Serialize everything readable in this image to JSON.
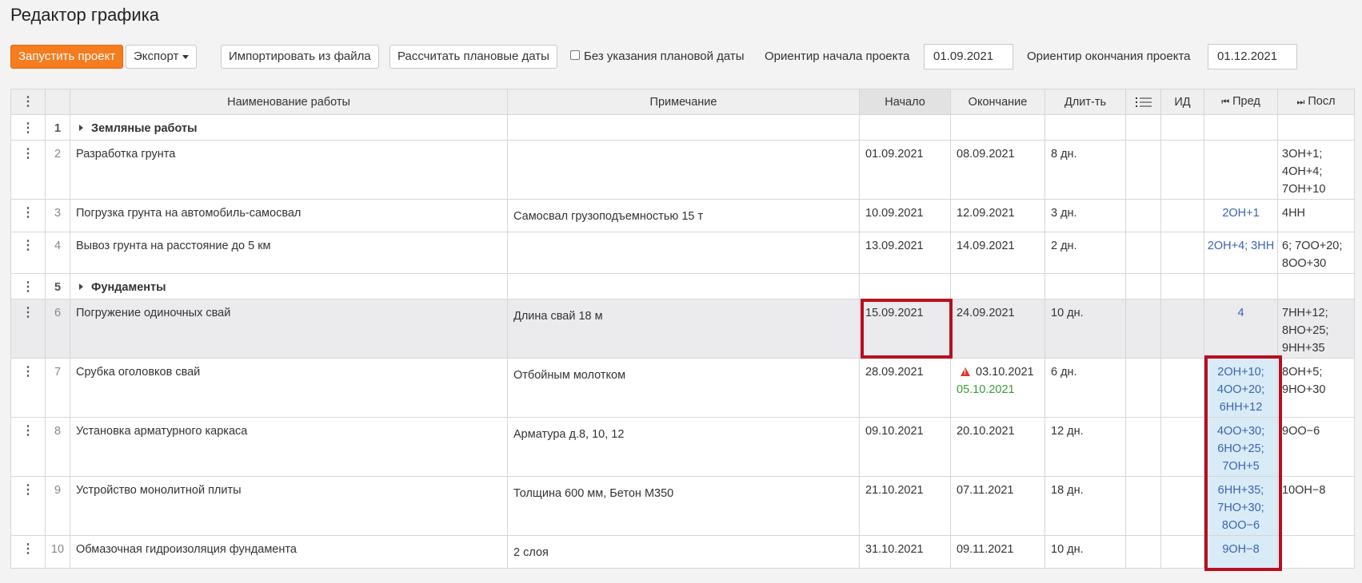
{
  "page": {
    "title": "Редактор графика"
  },
  "toolbar": {
    "run_label": "Запустить проект",
    "export_label": "Экспорт",
    "import_label": "Импортировать из файла",
    "calc_label": "Рассчитать плановые даты",
    "no_plan_label": "Без указания плановой даты",
    "start_label": "Ориентир начала проекта",
    "start_value": "01.09.2021",
    "end_label": "Ориентир окончания проекта",
    "end_value": "01.12.2021"
  },
  "table": {
    "headers": {
      "name": "Наименование работы",
      "note": "Примечание",
      "start": "Начало",
      "end": "Окончание",
      "dur": "Длит-ть",
      "id": "ИД",
      "pred": "Пред",
      "succ": "Посл"
    },
    "rows": [
      {
        "num": "1",
        "name": "Земляные работы",
        "group": true
      },
      {
        "num": "2",
        "name": "Разработка грунта",
        "note": "",
        "start": "01.09.2021",
        "end": "08.09.2021",
        "dur": "8 дн.",
        "pred": [],
        "succ": [
          "3ОН+1;",
          "4ОН+4;",
          "7ОН+10"
        ]
      },
      {
        "num": "3",
        "name": "Погрузка грунта на автомобиль-самосвал",
        "note": "Самосвал грузоподъемностью 15 т",
        "start": "10.09.2021",
        "end": "12.09.2021",
        "dur": "3 дн.",
        "pred": [
          "2ОН+1"
        ],
        "succ": [
          "4НН"
        ]
      },
      {
        "num": "4",
        "name": "Вывоз грунта на расстояние до 5 км",
        "note": "",
        "start": "13.09.2021",
        "end": "14.09.2021",
        "dur": "2 дн.",
        "pred": [
          "2ОН+4; 3НН"
        ],
        "succ": [
          "6; 7ОО+20;",
          "8ОО+30"
        ]
      },
      {
        "num": "5",
        "name": "Фундаменты",
        "group": true
      },
      {
        "num": "6",
        "name": "Погружение одиночных свай",
        "note": "Длина свай 18 м",
        "start": "15.09.2021",
        "end": "24.09.2021",
        "dur": "10 дн.",
        "pred": [
          "4"
        ],
        "succ": [
          "7НН+12;",
          "8НО+25;",
          "9НН+35"
        ]
      },
      {
        "num": "7",
        "name": "Срубка оголовков свай",
        "note": "Отбойным молотком",
        "start": "28.09.2021",
        "end": "03.10.2021",
        "end_new": "05.10.2021",
        "dur": "6 дн.",
        "pred": [
          "2ОН+10;",
          "4ОО+20;",
          "6НН+12"
        ],
        "succ": [
          "8ОН+5;",
          "9НО+30"
        ]
      },
      {
        "num": "8",
        "name": "Установка арматурного каркаса",
        "note": "Арматура д.8, 10, 12",
        "start": "09.10.2021",
        "end": "20.10.2021",
        "dur": "12 дн.",
        "pred": [
          "4ОО+30;",
          "6НО+25;",
          "7ОН+5"
        ],
        "succ": [
          "9ОО−6"
        ]
      },
      {
        "num": "9",
        "name": "Устройство монолитной плиты",
        "note": "Толщина 600 мм, Бетон М350",
        "start": "21.10.2021",
        "end": "07.11.2021",
        "dur": "18 дн.",
        "pred": [
          "6НН+35;",
          "7НО+30;",
          "8ОО−6"
        ],
        "succ": [
          "10ОН−8"
        ]
      },
      {
        "num": "10",
        "name": "Обмазочная гидроизоляция фундамента",
        "note": "2 слоя",
        "start": "31.10.2021",
        "end": "09.11.2021",
        "dur": "10 дн.",
        "pred": [
          "9ОН−8"
        ],
        "succ": []
      }
    ]
  },
  "icons": {
    "kebab": "⋮",
    "list": "list-icon",
    "first": "⏮",
    "last": "⏭",
    "warning": "warning-icon"
  },
  "colors": {
    "primary_button": "#f57c1f",
    "link_blue": "#3b64b0",
    "highlight": "#d9ebf6",
    "frame_red": "#b80f1f",
    "warning_red": "#d9342b",
    "green_date": "#3a9a3a"
  }
}
